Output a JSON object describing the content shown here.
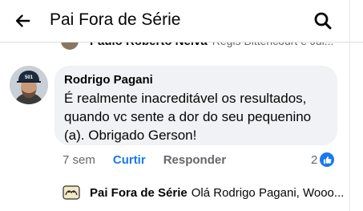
{
  "header": {
    "title": "Pai Fora de Série",
    "back_icon": "arrow-left-icon",
    "search_icon": "search-icon"
  },
  "previous_reply": {
    "name": "Paulo Roberto Neiva",
    "text": "Régis Bittencourt e Jul..."
  },
  "comment": {
    "avatar_badge": "501",
    "author": "Rodrigo Pagani",
    "text": "É realmente inacreditável os resultados, quando vc sente a dor do seu pequenino (a). Obrigado Gerson!",
    "time": "7 sem",
    "like_label": "Curtir",
    "reply_label": "Responder",
    "reaction_count": "2",
    "reaction_icon": "thumbs-up-icon"
  },
  "page_reply": {
    "name": "Pai Fora de Série",
    "text": "Olá Rodrigo Pagani, Wooo..."
  },
  "colors": {
    "accent": "#1877f2",
    "bubble": "#f0f2f5",
    "secondary_text": "#65676b"
  }
}
